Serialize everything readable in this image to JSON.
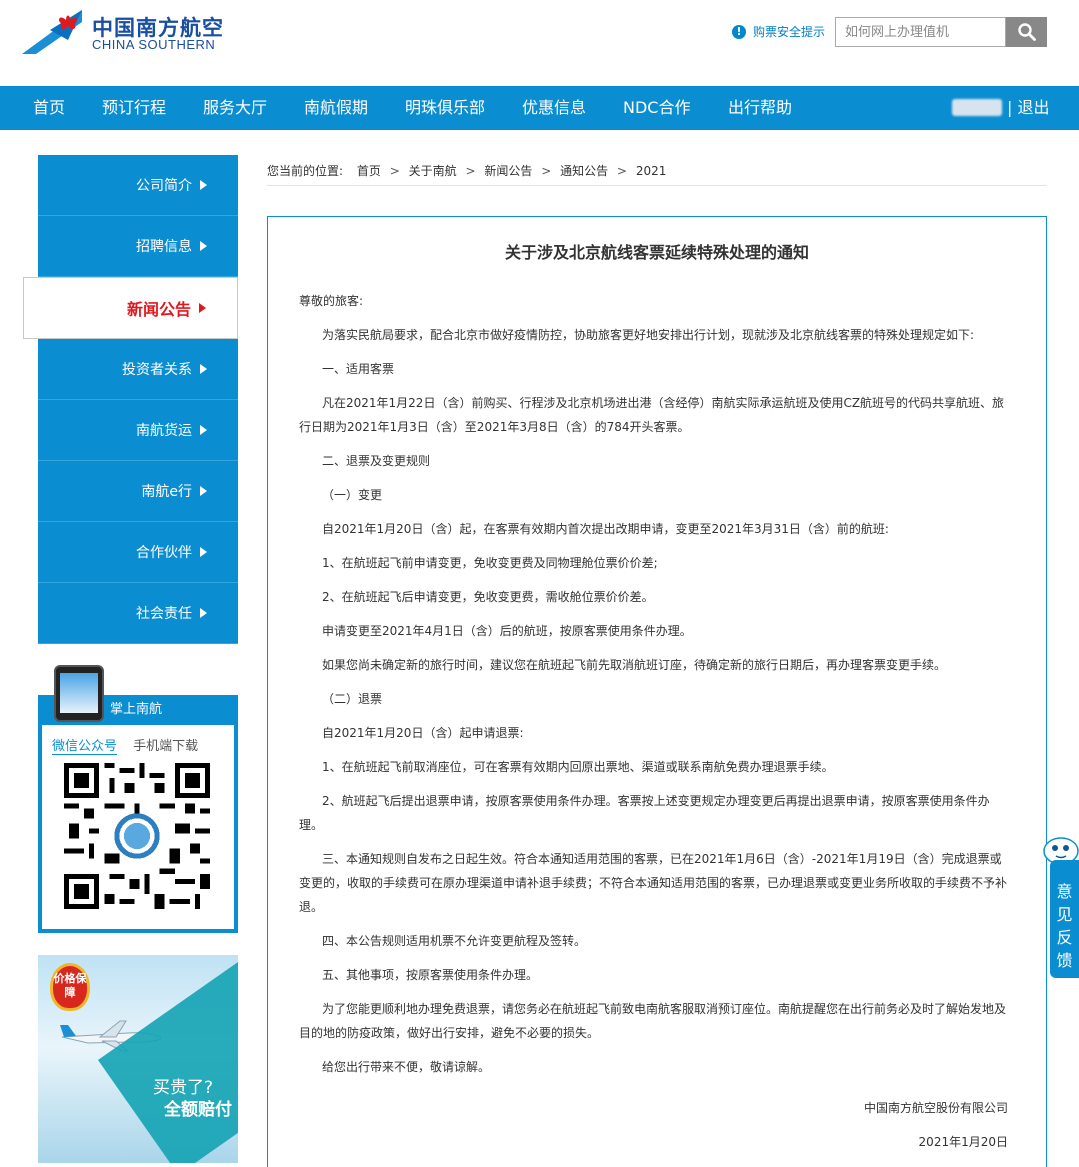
{
  "header": {
    "logo_cn": "中国南方航空",
    "logo_en": "CHINA SOUTHERN",
    "safety_tip": "购票安全提示",
    "search_placeholder": "如何网上办理值机"
  },
  "nav": {
    "items": [
      "首页",
      "预订行程",
      "服务大厅",
      "南航假期",
      "明珠俱乐部",
      "优惠信息",
      "NDC合作",
      "出行帮助"
    ],
    "logout": "| 退出"
  },
  "sidebar": {
    "items": [
      "公司简介",
      "招聘信息",
      "新闻公告",
      "投资者关系",
      "南航货运",
      "南航e行",
      "合作伙伴",
      "社会责任"
    ],
    "active_index": 2
  },
  "app_box": {
    "title": "掌上南航",
    "tabs": [
      "微信公众号",
      "手机端下载"
    ]
  },
  "promo": {
    "badge": "价格保障",
    "line1": "买贵了?",
    "line2": "全额赔付"
  },
  "breadcrumb": {
    "prefix": "您当前的位置:",
    "items": [
      "首页",
      "关于南航",
      "新闻公告",
      "通知公告",
      "2021"
    ]
  },
  "article": {
    "title": "关于涉及北京航线客票延续特殊处理的通知",
    "paragraphs": [
      "尊敬的旅客:",
      "为落实民航局要求，配合北京市做好疫情防控，协助旅客更好地安排出行计划，现就涉及北京航线客票的特殊处理规定如下:",
      "一、适用客票",
      "凡在2021年1月22日（含）前购买、行程涉及北京机场进出港（含经停）南航实际承运航班及使用CZ航班号的代码共享航班、旅行日期为2021年1月3日（含）至2021年3月8日（含）的784开头客票。",
      "二、退票及变更规则",
      "（一）变更",
      "自2021年1月20日（含）起，在客票有效期内首次提出改期申请，变更至2021年3月31日（含）前的航班:",
      "1、在航班起飞前申请变更，免收变更费及同物理舱位票价价差;",
      "2、在航班起飞后申请变更，免收变更费，需收舱位票价价差。",
      "申请变更至2021年4月1日（含）后的航班，按原客票使用条件办理。",
      "如果您尚未确定新的旅行时间，建议您在航班起飞前先取消航班订座，待确定新的旅行日期后，再办理客票变更手续。",
      "（二）退票",
      "自2021年1月20日（含）起申请退票:",
      "1、在航班起飞前取消座位，可在客票有效期内回原出票地、渠道或联系南航免费办理退票手续。",
      "2、航班起飞后提出退票申请，按原客票使用条件办理。客票按上述变更规定办理变更后再提出退票申请，按原客票使用条件办理。",
      "三、本通知规则自发布之日起生效。符合本通知适用范围的客票，已在2021年1月6日（含）-2021年1月19日（含）完成退票或变更的，收取的手续费可在原办理渠道申请补退手续费；不符合本通知适用范围的客票，已办理退票或变更业务所收取的手续费不予补退。",
      "四、本公告规则适用机票不允许变更航程及签转。",
      "五、其他事项，按原客票使用条件办理。",
      "为了您能更顺利地办理免费退票，请您务必在航班起飞前致电南航客服取消预订座位。南航提醒您在出行前务必及时了解始发地及目的地的防疫政策，做好出行安排，避免不必要的损失。",
      "给您出行带来不便，敬请谅解。"
    ],
    "signature": "中国南方航空股份有限公司",
    "date": "2021年1月20日"
  },
  "feedback": {
    "label": "意见反馈"
  }
}
